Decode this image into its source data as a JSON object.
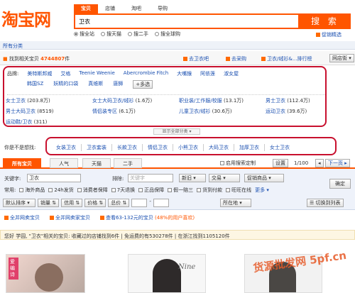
{
  "header": {
    "logo": "淘宝网",
    "search_tabs": [
      "宝贝",
      "店铺",
      "淘吧",
      "导购"
    ],
    "search_value": "卫衣",
    "search_button": "搜 索",
    "radios": [
      "搜全站",
      "搜天猫",
      "搜二手",
      "搜全球购"
    ],
    "promo_text": "促销精选"
  },
  "nav": {
    "category": "所有分类"
  },
  "results_bar": {
    "prefix": "找到相关宝贝",
    "count": "4744807",
    "suffix": "件",
    "links": [
      "去卫衣吧",
      "去采购",
      "卫衣/绒衫&...排行榜"
    ],
    "site_select": "网店街"
  },
  "attributes": {
    "label": "品牌:",
    "brands": [
      "美特斯邦威",
      "艾格",
      "Teenie Weenie",
      "Abercrombie Fitch",
      "大嘴猴",
      "阿依莲",
      "淑女屋"
    ],
    "brands2": [
      "韩国SZ",
      "妖精的口袋",
      "真维斯",
      "唐狮"
    ],
    "more": "+多选",
    "cats": [
      [
        "女士卫衣",
        "(203.8万)"
      ],
      [
        "女士大码卫衣/绒衫",
        "(1.6万)"
      ],
      [
        "职业装/工作服/校服",
        "(13.1万)"
      ],
      [
        "男士卫衣",
        "(112.4万)"
      ],
      [
        "男士大码卫衣",
        "(8519)"
      ],
      [
        "情侣装专区",
        "(6.1万)"
      ],
      [
        "儿童卫衣/绒衫",
        "(30.6万)"
      ],
      [
        "运动卫衣",
        "(39.6万)"
      ],
      [
        "运动鞋/卫衣",
        "(311)"
      ]
    ],
    "expand": "显示全部分类"
  },
  "suggest": {
    "label": "你是不是想找:",
    "terms": [
      "女装卫衣",
      "卫衣套装",
      "长款卫衣",
      "情侣卫衣",
      "小熊卫衣",
      "大码卫衣",
      "加厚卫衣",
      "女士卫衣"
    ]
  },
  "content_tabs": {
    "tabs": [
      "所有宝贝",
      "人气",
      "天猫",
      "二手"
    ],
    "use_search": "启用搜索定制",
    "setting": "设置",
    "page": "1/100",
    "next": "下一页"
  },
  "filter": {
    "keyword_label": "关键字:",
    "keyword_value": "卫衣",
    "exclude_label": "排除:",
    "exclude_placeholder": "关键字",
    "sel1": "新旧",
    "sel2": "交易",
    "sel3": "促销商品",
    "confirm": "确定",
    "common_label": "常用:",
    "checks": [
      "海外商品",
      "24h发货",
      "消费者保障",
      "7天退换",
      "正品保障",
      "假一赔三",
      "货到付款",
      "旺旺在线"
    ],
    "more": "更多",
    "sort_default": "默认排序",
    "sort_items": [
      "销量",
      "信用",
      "价格",
      "总价"
    ],
    "location": "所在地",
    "view_switch": "切换到列表"
  },
  "promo": {
    "a": "全并网卖宝贝",
    "b": "全并网卖家宝贝",
    "c": "查看63-132元的宝贝",
    "c2": "(48%的用户喜欢)"
  },
  "info_bar": {
    "text": "您好 学园, \"卫衣\"相关的宝贝: 收藏过的店铺找到6件 | 免运费的有530278件 | 在浙江找到1105120件"
  },
  "thumbs": {
    "caption1": "爱编诗",
    "caption2": "Nine"
  },
  "watermark": "货源批发网 5pf.cn"
}
